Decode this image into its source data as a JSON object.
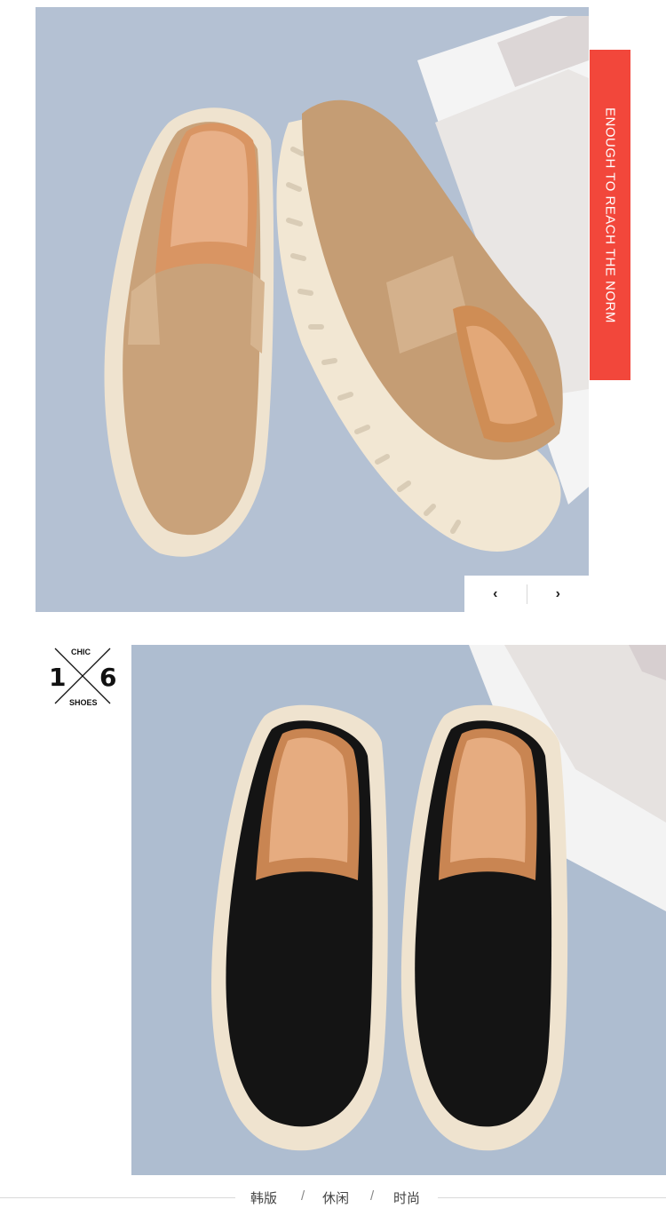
{
  "banner": {
    "text": "ENOUGH TO REACH THE NORM"
  },
  "carousel": {
    "prev_label": "‹",
    "next_label": "›"
  },
  "logo": {
    "top": "CHIC",
    "bottom": "SHOES",
    "left_num": "1",
    "right_num": "6"
  },
  "tags": {
    "items": [
      "韩版",
      "休闲",
      "时尚"
    ],
    "separator": "/"
  },
  "colors": {
    "banner": "#f2473b",
    "bg_blue": "#b4c1d3",
    "suede_tan": "#c9a27a",
    "suede_black": "#141414",
    "sole": "#efe3cf"
  },
  "products": [
    {
      "name": "tan-suede-slip-on-photo"
    },
    {
      "name": "black-suede-slip-on-photo"
    }
  ]
}
